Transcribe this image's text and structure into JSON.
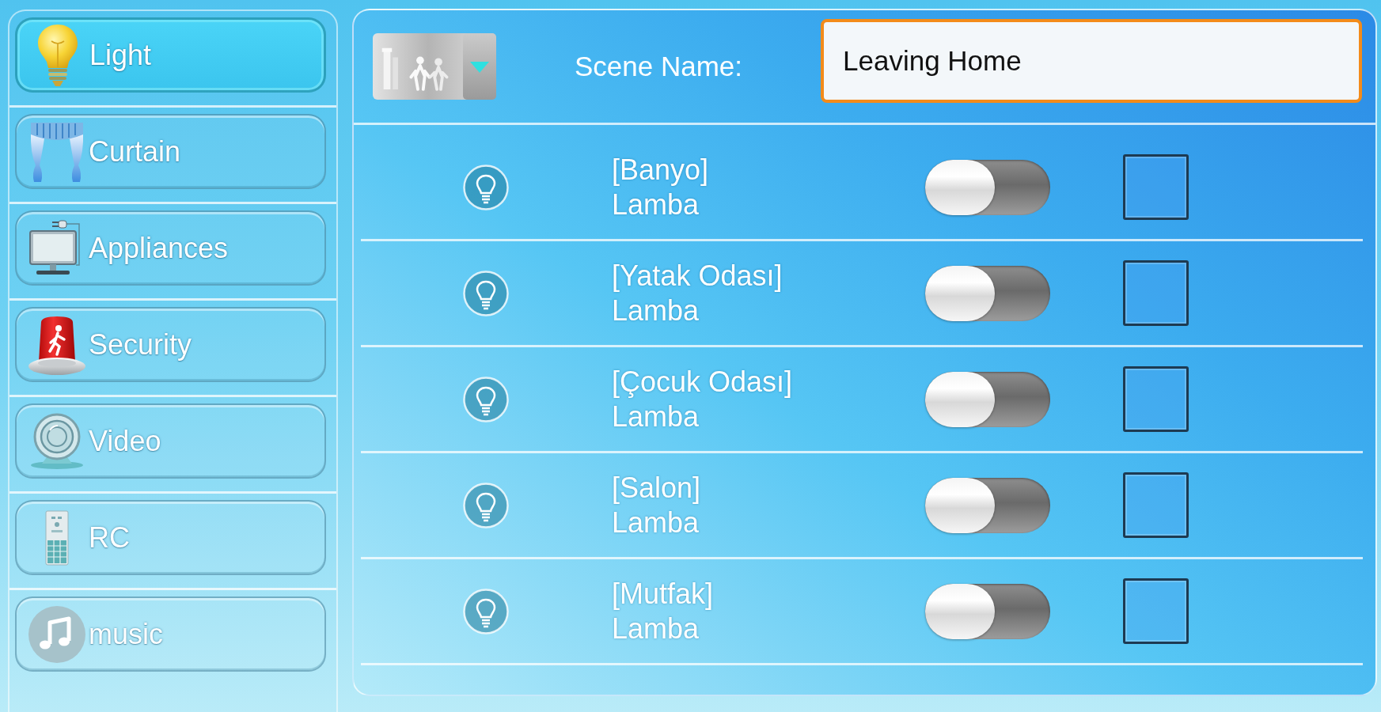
{
  "sidebar": {
    "items": [
      {
        "kind": "light",
        "label": "Light",
        "selected": true
      },
      {
        "kind": "curtain",
        "label": "Curtain",
        "selected": false
      },
      {
        "kind": "appliances",
        "label": "Appliances",
        "selected": false
      },
      {
        "kind": "security",
        "label": "Security",
        "selected": false
      },
      {
        "kind": "video",
        "label": "Video",
        "selected": false
      },
      {
        "kind": "rc",
        "label": "RC",
        "selected": false
      },
      {
        "kind": "music",
        "label": "music",
        "selected": false
      }
    ]
  },
  "scene": {
    "label": "Scene Name:",
    "value": "Leaving Home",
    "focused": true
  },
  "rows": [
    {
      "room": "[Banyo]",
      "device": "Lamba",
      "on": false,
      "checked": false
    },
    {
      "room": "[Yatak Odası]",
      "device": "Lamba",
      "on": false,
      "checked": false
    },
    {
      "room": "[Çocuk Odası]",
      "device": "Lamba",
      "on": false,
      "checked": false
    },
    {
      "room": "[Salon]",
      "device": "Lamba",
      "on": false,
      "checked": false
    },
    {
      "room": "[Mutfak]",
      "device": "Lamba",
      "on": false,
      "checked": false
    }
  ]
}
